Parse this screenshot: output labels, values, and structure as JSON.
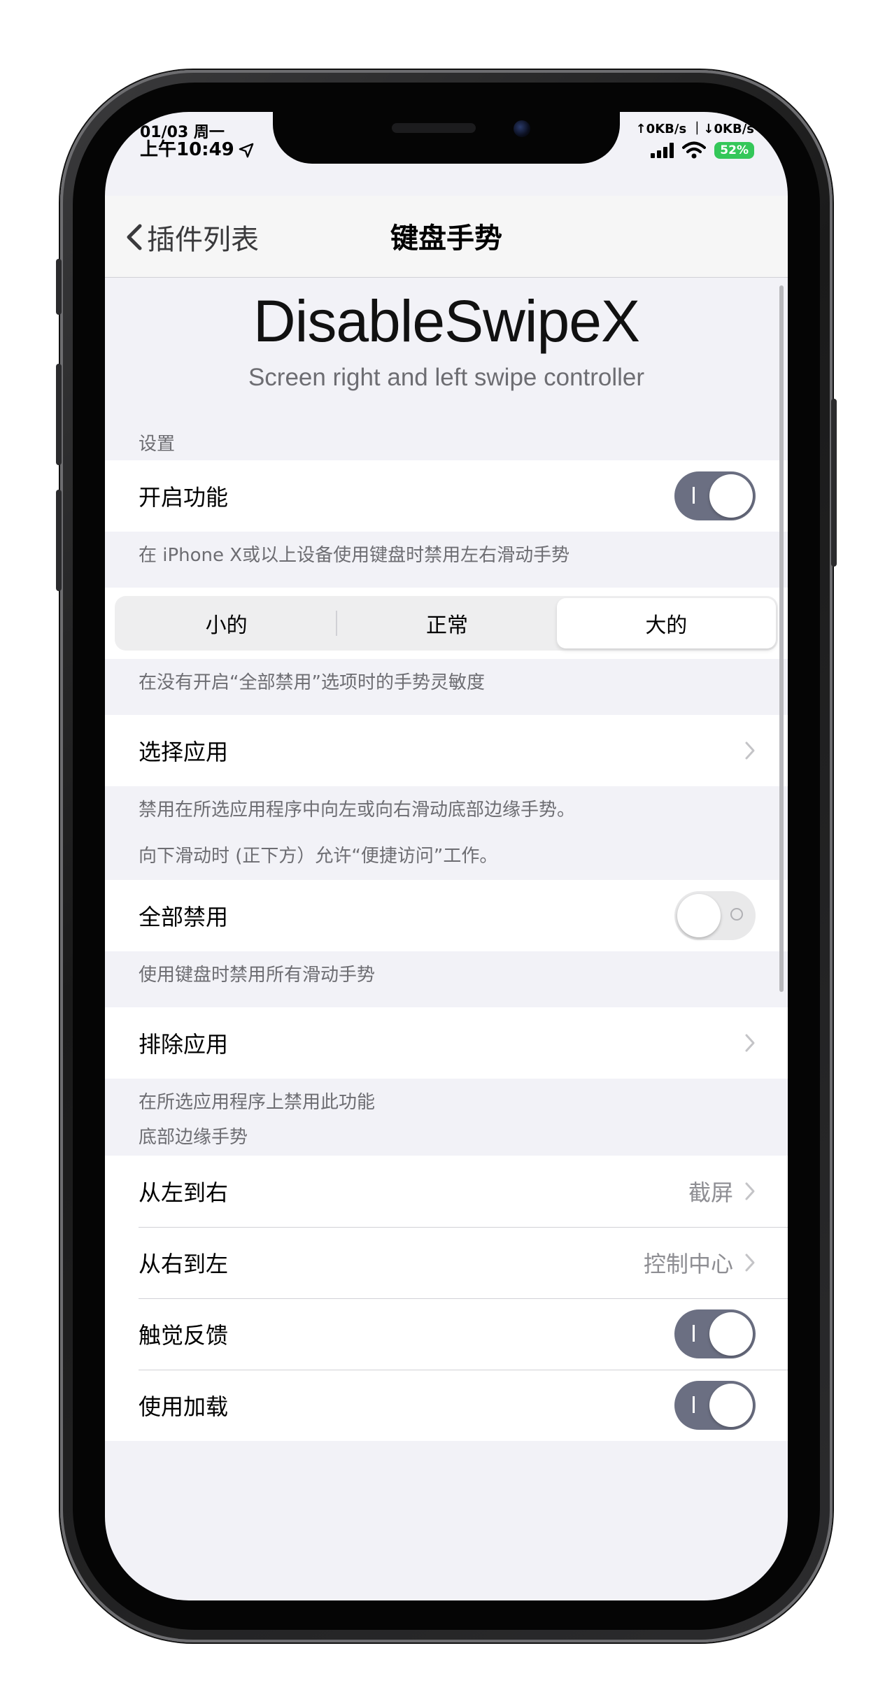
{
  "status_bar": {
    "date": "01/03 周一",
    "time": "上午10:49",
    "net_speed": "↑0KB/s ｜↓0KB/s",
    "battery": "52%"
  },
  "navbar": {
    "back_label": "插件列表",
    "title": "键盘手势"
  },
  "hero": {
    "title": "DisableSwipeX",
    "subtitle": "Screen right and left swipe controller"
  },
  "settings_section": {
    "header": "设置",
    "enable_label": "开启功能",
    "enable_on": true,
    "enable_footer": "在 iPhone X或以上设备使用键盘时禁用左右滑动手势"
  },
  "sensitivity": {
    "options": [
      "小的",
      "正常",
      "大的"
    ],
    "selected": "大的",
    "footer": "在没有开启“全部禁用”选项时的手势灵敏度"
  },
  "select_apps": {
    "label": "选择应用",
    "footer_line1": "禁用在所选应用程序中向左或向右滑动底部边缘手势。",
    "footer_line2": "向下滑动时 (正下方）允许“便捷访问”工作。"
  },
  "disable_all": {
    "label": "全部禁用",
    "on": false,
    "footer": "使用键盘时禁用所有滑动手势"
  },
  "exclude_apps": {
    "label": "排除应用",
    "footer": "在所选应用程序上禁用此功能"
  },
  "bottom_edge": {
    "header": "底部边缘手势",
    "left_to_right_label": "从左到右",
    "left_to_right_value": "截屏",
    "right_to_left_label": "从右到左",
    "right_to_left_value": "控制中心",
    "haptic_label": "触觉反馈",
    "haptic_on": true,
    "use_load_label": "使用加载",
    "use_load_on": true
  },
  "colors": {
    "toggle_on": "#6b6f82",
    "battery": "#34c759",
    "background": "#f2f2f7"
  }
}
